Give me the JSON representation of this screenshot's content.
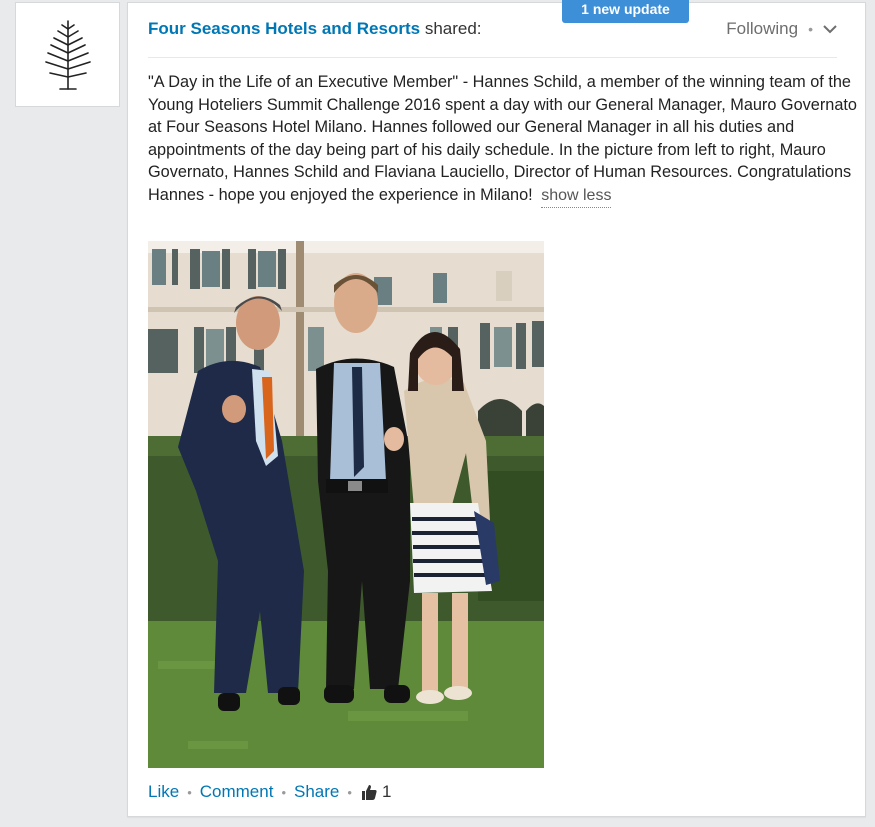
{
  "notification": {
    "label": "1 new update"
  },
  "post": {
    "actor_name": "Four Seasons Hotels and Resorts",
    "action": "shared:",
    "follow_label": "Following",
    "text": "\"A Day in the Life of an Executive Member\" - Hannes Schild, a member of the winning team of the Young Hoteliers Summit Challenge 2016 spent a day with our General Manager, Mauro Governato at Four Seasons Hotel Milano. Hannes followed our General Manager in all his duties and appointments of the day being part of his daily schedule. In the picture from left to right, Mauro Governato, Hannes Schild and Flaviana Lauciello, Director of Human Resources. Congratulations Hannes - hope you enjoyed the experience in Milano!",
    "show_less": "show less"
  },
  "actions": {
    "like": "Like",
    "comment": "Comment",
    "share": "Share",
    "like_count": "1"
  },
  "colors": {
    "link": "#0077b5",
    "pill": "#3d8fd8",
    "background": "#e9eaec"
  }
}
